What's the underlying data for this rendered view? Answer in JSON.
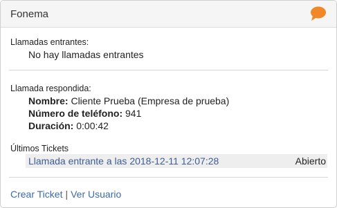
{
  "header": {
    "title": "Fonema",
    "icon": "chat-bubble-icon",
    "icon_color": "#f0882a"
  },
  "incoming": {
    "label": "Llamadas entrantes:",
    "message": "No hay llamadas entrantes"
  },
  "answered": {
    "label": "Llamada respondida:",
    "name_label": "Nombre:",
    "name_value": "Cliente Prueba (Empresa de prueba)",
    "phone_label": "Número de teléfono:",
    "phone_value": "941",
    "duration_label": "Duración:",
    "duration_value": "0:00:42"
  },
  "tickets": {
    "label": "Últimos Tickets",
    "items": [
      {
        "title": "Llamada entrante a las 2018-12-11 12:07:28",
        "status": "Abierto"
      }
    ]
  },
  "footer": {
    "create_ticket": "Crear Ticket",
    "separator": "|",
    "view_user": "Ver Usuario"
  },
  "colors": {
    "link": "#3d5c94",
    "ticket_row_bg": "#eeeeee"
  }
}
